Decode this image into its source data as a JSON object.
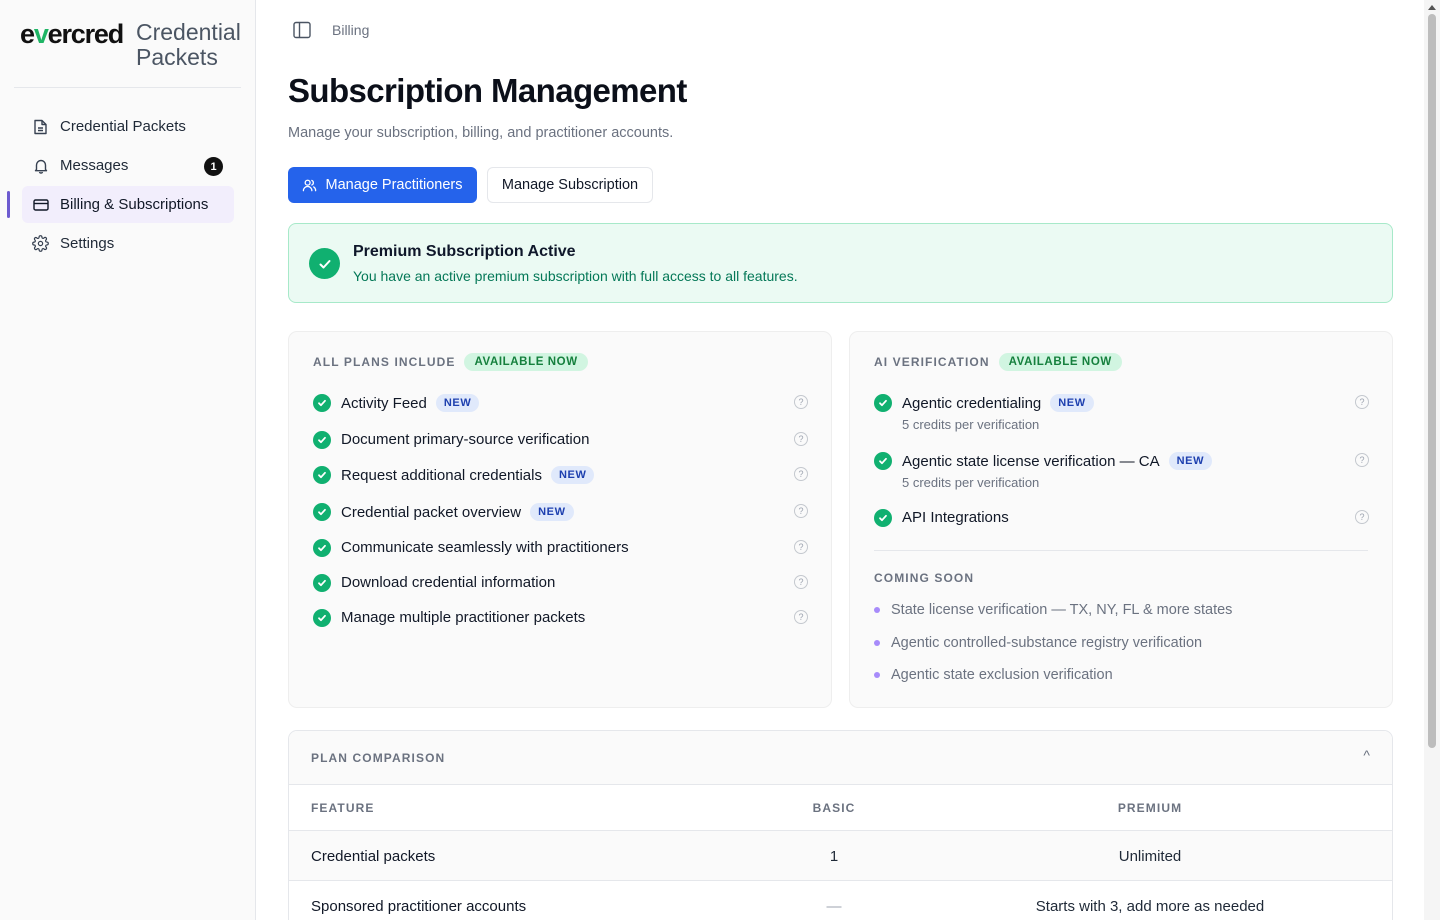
{
  "brand": {
    "logo_text_prefix": "e",
    "logo_text_v": "v",
    "logo_text_suffix": "ercred",
    "product_line1": "Credential",
    "product_line2": "Packets"
  },
  "sidebar": {
    "items": [
      {
        "label": "Credential Packets",
        "icon": "document-icon"
      },
      {
        "label": "Messages",
        "icon": "bell-icon",
        "badge": "1"
      },
      {
        "label": "Billing & Subscriptions",
        "icon": "credit-card-icon",
        "active": true
      },
      {
        "label": "Settings",
        "icon": "gear-icon"
      }
    ]
  },
  "header": {
    "breadcrumb": "Billing"
  },
  "page": {
    "title": "Subscription Management",
    "subtitle": "Manage your subscription, billing, and practitioner accounts."
  },
  "actions": {
    "primary_label": "Manage Practitioners",
    "secondary_label": "Manage Subscription"
  },
  "alert": {
    "title": "Premium Subscription Active",
    "description": "You have an active premium subscription with full access to all features."
  },
  "plans_card": {
    "eyebrow": "ALL PLANS INCLUDE",
    "status": "AVAILABLE NOW",
    "features": [
      {
        "label": "Activity Feed",
        "badge": "NEW"
      },
      {
        "label": "Document primary-source verification",
        "badge": ""
      },
      {
        "label": "Request additional credentials",
        "badge": "NEW"
      },
      {
        "label": "Credential packet overview",
        "badge": "NEW"
      },
      {
        "label": "Communicate seamlessly with practitioners",
        "badge": ""
      },
      {
        "label": "Download credential information",
        "badge": ""
      },
      {
        "label": "Manage multiple practitioner packets",
        "badge": ""
      }
    ]
  },
  "ai_card": {
    "eyebrow": "AI VERIFICATION",
    "status": "AVAILABLE NOW",
    "features": [
      {
        "label": "Agentic credentialing",
        "badge": "NEW",
        "sub": "5 credits per verification"
      },
      {
        "label": "Agentic state license verification — CA",
        "badge": "NEW",
        "sub": "5 credits per verification"
      },
      {
        "label": "API Integrations",
        "badge": "",
        "sub": ""
      }
    ],
    "coming_soon_title": "COMING SOON",
    "coming_soon": [
      "State license verification — TX, NY, FL & more states",
      "Agentic controlled-substance registry verification",
      "Agentic state exclusion verification"
    ]
  },
  "comparison": {
    "title": "PLAN COMPARISON",
    "collapse_glyph": "^",
    "headers": [
      "FEATURE",
      "BASIC",
      "PREMIUM"
    ],
    "rows": [
      [
        "Credential packets",
        "1",
        "Unlimited"
      ],
      [
        "Sponsored practitioner accounts",
        "—",
        "Starts with 3, add more as needed"
      ]
    ]
  },
  "help_glyph": "?",
  "colors": {
    "primary": "#2563eb",
    "success": "#10b070",
    "brand_green": "#1fb565",
    "active_nav": "#f2eefc",
    "coming_soon_dot": "#a78bfa"
  }
}
